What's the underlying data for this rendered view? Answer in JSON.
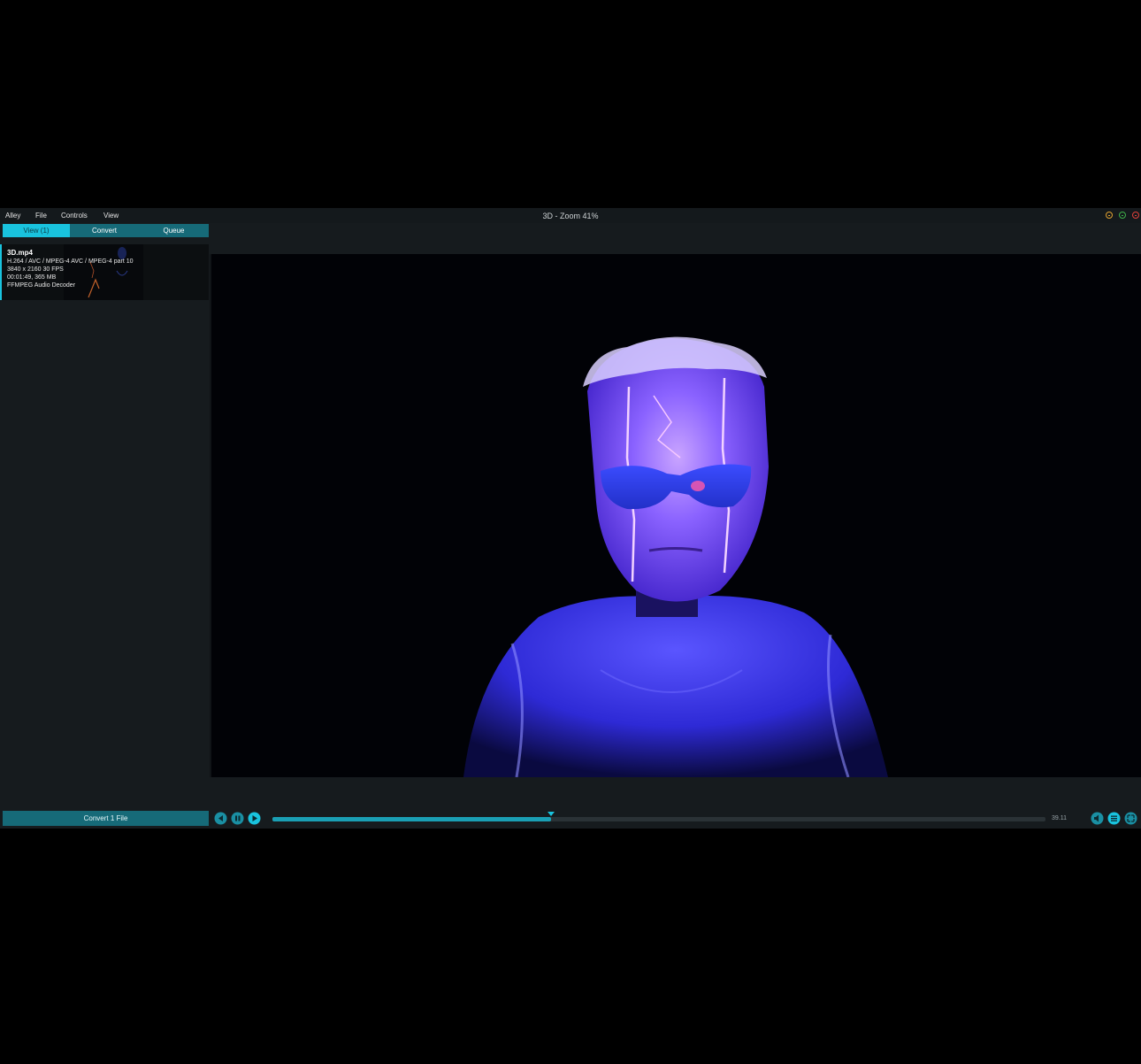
{
  "menubar": {
    "items": [
      "Alley",
      "File",
      "Controls",
      "View"
    ],
    "window_title": "3D - Zoom 41%"
  },
  "tabs": [
    {
      "label": "View (1)",
      "active": true
    },
    {
      "label": "Convert",
      "active": false
    },
    {
      "label": "Queue",
      "active": false
    }
  ],
  "file": {
    "name": "3D.mp4",
    "codec": "H.264 / AVC / MPEG-4 AVC / MPEG-4 part 10",
    "resolution": "3840 x 2160 30 FPS",
    "duration_size": "00:01:49, 365 MB",
    "audio": "FFMPEG Audio Decoder"
  },
  "bottom": {
    "convert_label": "Convert 1 File",
    "time": "39.11",
    "progress": 0.36,
    "marker_position": 0.36
  },
  "colors": {
    "accent": "#19c3de",
    "accent_dark": "#166a78",
    "panel_bg": "#161b1e",
    "video_glow": "#7a5cff"
  },
  "icons": {
    "previous": "skip-back-icon",
    "pause": "pause-icon",
    "play": "play-icon",
    "volume": "volume-icon",
    "playlist": "playlist-icon",
    "fullscreen": "fullscreen-icon"
  }
}
